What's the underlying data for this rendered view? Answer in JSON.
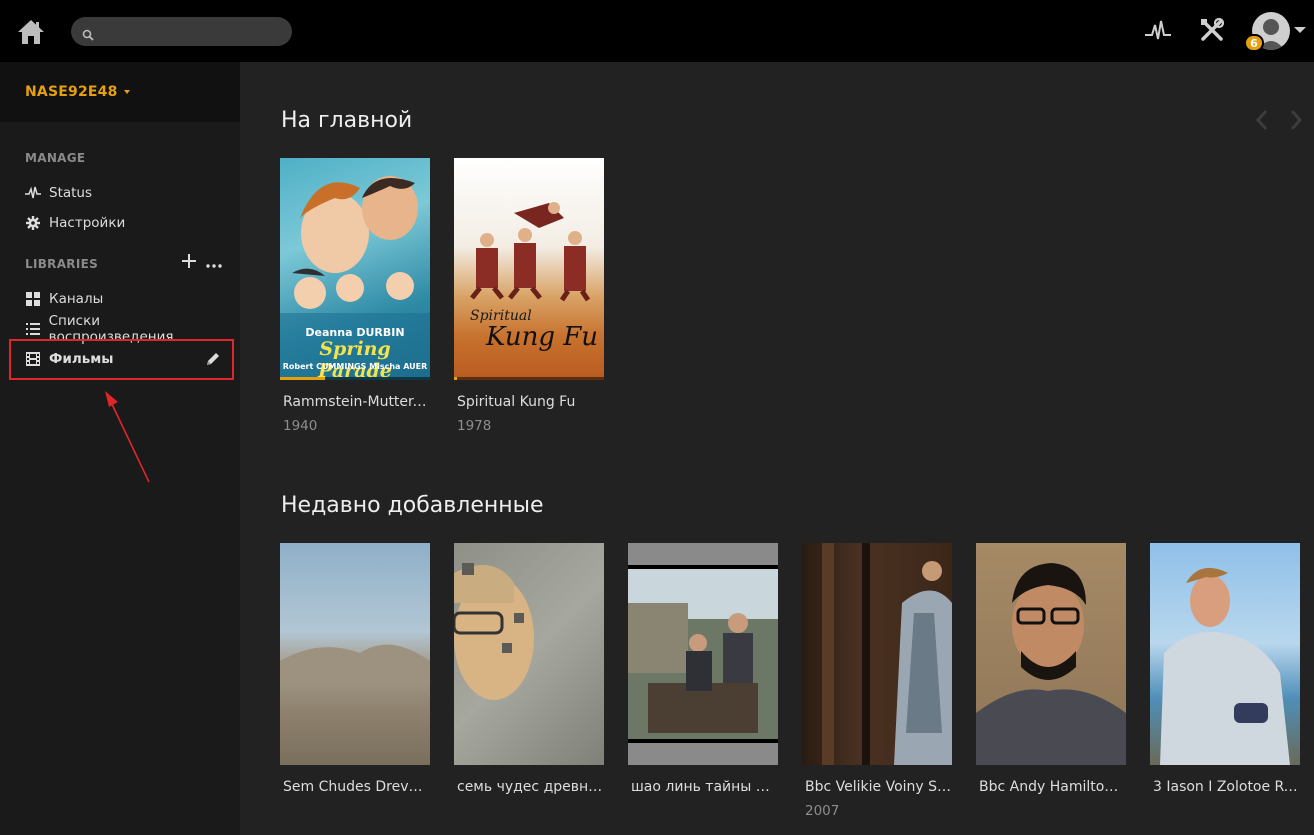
{
  "topbar": {
    "search": {
      "value": "",
      "placeholder": ""
    },
    "notification_count": "6"
  },
  "sidebar": {
    "server_name": "NASE92E48",
    "manage_heading": "MANAGE",
    "manage_items": [
      {
        "label": "Status",
        "icon": "activity-icon"
      },
      {
        "label": "Настройки",
        "icon": "gear-icon"
      }
    ],
    "libraries_heading": "LIBRARIES",
    "library_items": [
      {
        "label": "Каналы",
        "icon": "grid-icon"
      },
      {
        "label": "Списки воспроизведения",
        "icon": "list-icon"
      },
      {
        "label": "Фильмы",
        "icon": "film-icon"
      }
    ]
  },
  "main": {
    "sections": [
      {
        "title": "На главной",
        "items": [
          {
            "title": "Rammstein-Mutter.…",
            "year": "1940",
            "progress": 0.3
          },
          {
            "title": "Spiritual Kung Fu",
            "year": "1978",
            "progress": 0.02
          }
        ]
      },
      {
        "title": "Недавно добавленные",
        "items": [
          {
            "title": "Sem Chudes Drevn…",
            "year": ""
          },
          {
            "title": "семь чудес древне…",
            "year": ""
          },
          {
            "title": "шао линь тайны и…",
            "year": ""
          },
          {
            "title": "Bbc Velikie Voiny Sh…",
            "year": "2007"
          },
          {
            "title": "Bbc Andy Hamilton'…",
            "year": ""
          },
          {
            "title": "3 Iason I Zolotoe Ru…",
            "year": ""
          }
        ]
      }
    ]
  },
  "posters": {
    "p1_text_1": "Deanna DURBIN",
    "p1_text_2": "Spring Parade",
    "p1_text_3": "Robert CUMMINGS   Mischa AUER",
    "p2_text_1": "Spiritual",
    "p2_text_2": "Kung Fu"
  },
  "colors": {
    "accent": "#e5a00d",
    "highlight_box": "#e0252b",
    "annotation_arrow": "#e0252b"
  }
}
